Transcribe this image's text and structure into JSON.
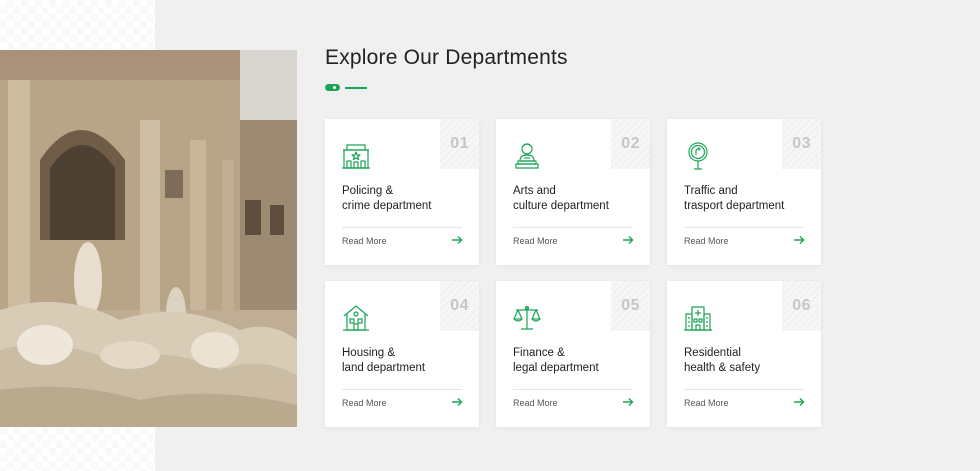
{
  "section": {
    "title": "Explore Our Departments"
  },
  "colors": {
    "accent": "#1aa556",
    "background": "#f0f0f0"
  },
  "departments": [
    {
      "number": "01",
      "line1": "Policing &",
      "line2": "crime department",
      "icon": "police-station-icon",
      "link": "Read More"
    },
    {
      "number": "02",
      "line1": "Arts and",
      "line2": "culture department",
      "icon": "bust-statue-icon",
      "link": "Read More"
    },
    {
      "number": "03",
      "line1": "Traffic and",
      "line2": "trasport department",
      "icon": "road-sign-icon",
      "link": "Read More"
    },
    {
      "number": "04",
      "line1": "Housing &",
      "line2": "land department",
      "icon": "house-icon",
      "link": "Read More"
    },
    {
      "number": "05",
      "line1": "Finance &",
      "line2": "legal department",
      "icon": "scales-icon",
      "link": "Read More"
    },
    {
      "number": "06",
      "line1": "Residential",
      "line2": "health & safety",
      "icon": "hospital-icon",
      "link": "Read More"
    }
  ]
}
